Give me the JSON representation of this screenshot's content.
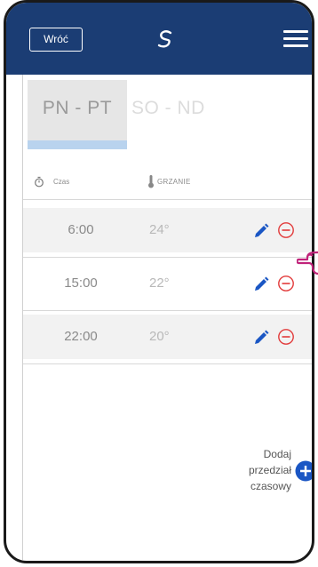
{
  "header": {
    "back_label": "Wróć",
    "logo_icon": "salus-swirl-logo",
    "menu_icon": "hamburger-menu-icon",
    "bg_color": "#1b3d74"
  },
  "tabs": {
    "active_label": "PN - PT",
    "inactive_label": "SO - ND"
  },
  "columns": {
    "time_label": "Czas",
    "heat_label": "GRZANIE"
  },
  "rows": [
    {
      "time": "6:00",
      "temp": "24°"
    },
    {
      "time": "15:00",
      "temp": "22°"
    },
    {
      "time": "22:00",
      "temp": "20°"
    }
  ],
  "add": {
    "line1": "Dodaj",
    "line2": "przedział",
    "line3": "czasowy"
  },
  "colors": {
    "accent_blue": "#1a56c4",
    "remove_red": "#e23b3b",
    "highlight_magenta": "#c0237a"
  }
}
